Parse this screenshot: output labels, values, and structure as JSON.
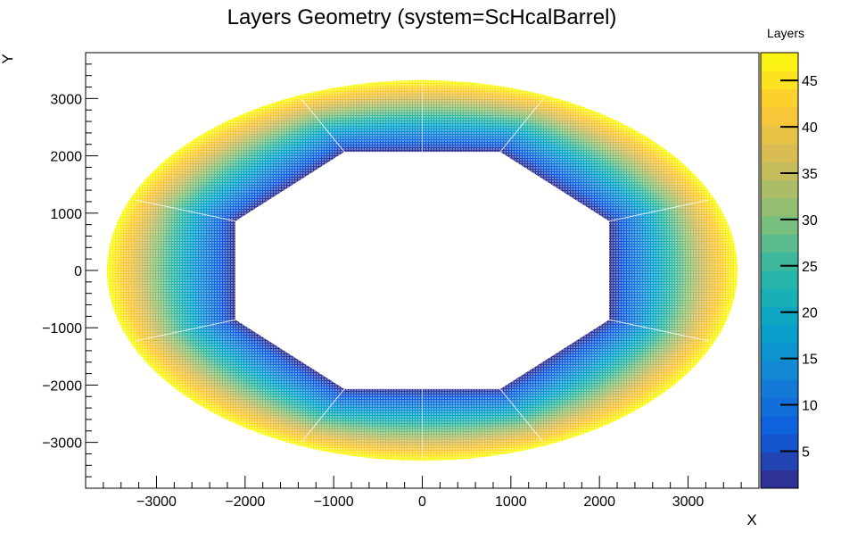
{
  "chart_data": {
    "type": "scatter",
    "title": "Layers Geometry (system=ScHcalBarrel)",
    "xlabel": "X",
    "ylabel": "Y",
    "xlim": [
      -3800,
      3800
    ],
    "ylim": [
      -3800,
      3800
    ],
    "xticks": [
      -3000,
      -2000,
      -1000,
      0,
      1000,
      2000,
      3000
    ],
    "yticks": [
      3000,
      2000,
      1000,
      0,
      -1000,
      -2000,
      -3000
    ],
    "xtick_labels": [
      "−3000",
      "−2000",
      "−1000",
      "0",
      "1000",
      "2000",
      "3000"
    ],
    "ytick_labels": [
      "3000",
      "2000",
      "1000",
      "0",
      "−1000",
      "−2000",
      "−3000"
    ],
    "shape": {
      "inner_octagon": [
        [
          -880,
          2070
        ],
        [
          880,
          2070
        ],
        [
          2110,
          860
        ],
        [
          2110,
          -860
        ],
        [
          880,
          -2070
        ],
        [
          -880,
          -2070
        ],
        [
          -2110,
          -860
        ],
        [
          -2110,
          860
        ]
      ],
      "outer_ellipse_rx": 3560,
      "outer_ellipse_ry": 3320
    },
    "colorbar": {
      "label": "Layers",
      "min": 1,
      "max": 48,
      "ticks": [
        5,
        10,
        15,
        20,
        25,
        30,
        35,
        40,
        45
      ],
      "tick_labels": [
        "5",
        "10",
        "15",
        "20",
        "25",
        "30",
        "35",
        "40",
        "45"
      ]
    },
    "colormap": [
      "#352a87",
      "#0f5cdd",
      "#1481d6",
      "#06a4ca",
      "#2eb7a4",
      "#87bf77",
      "#d1bb59",
      "#fec832",
      "#f9fb0e"
    ],
    "grid": false,
    "legend": "none"
  }
}
